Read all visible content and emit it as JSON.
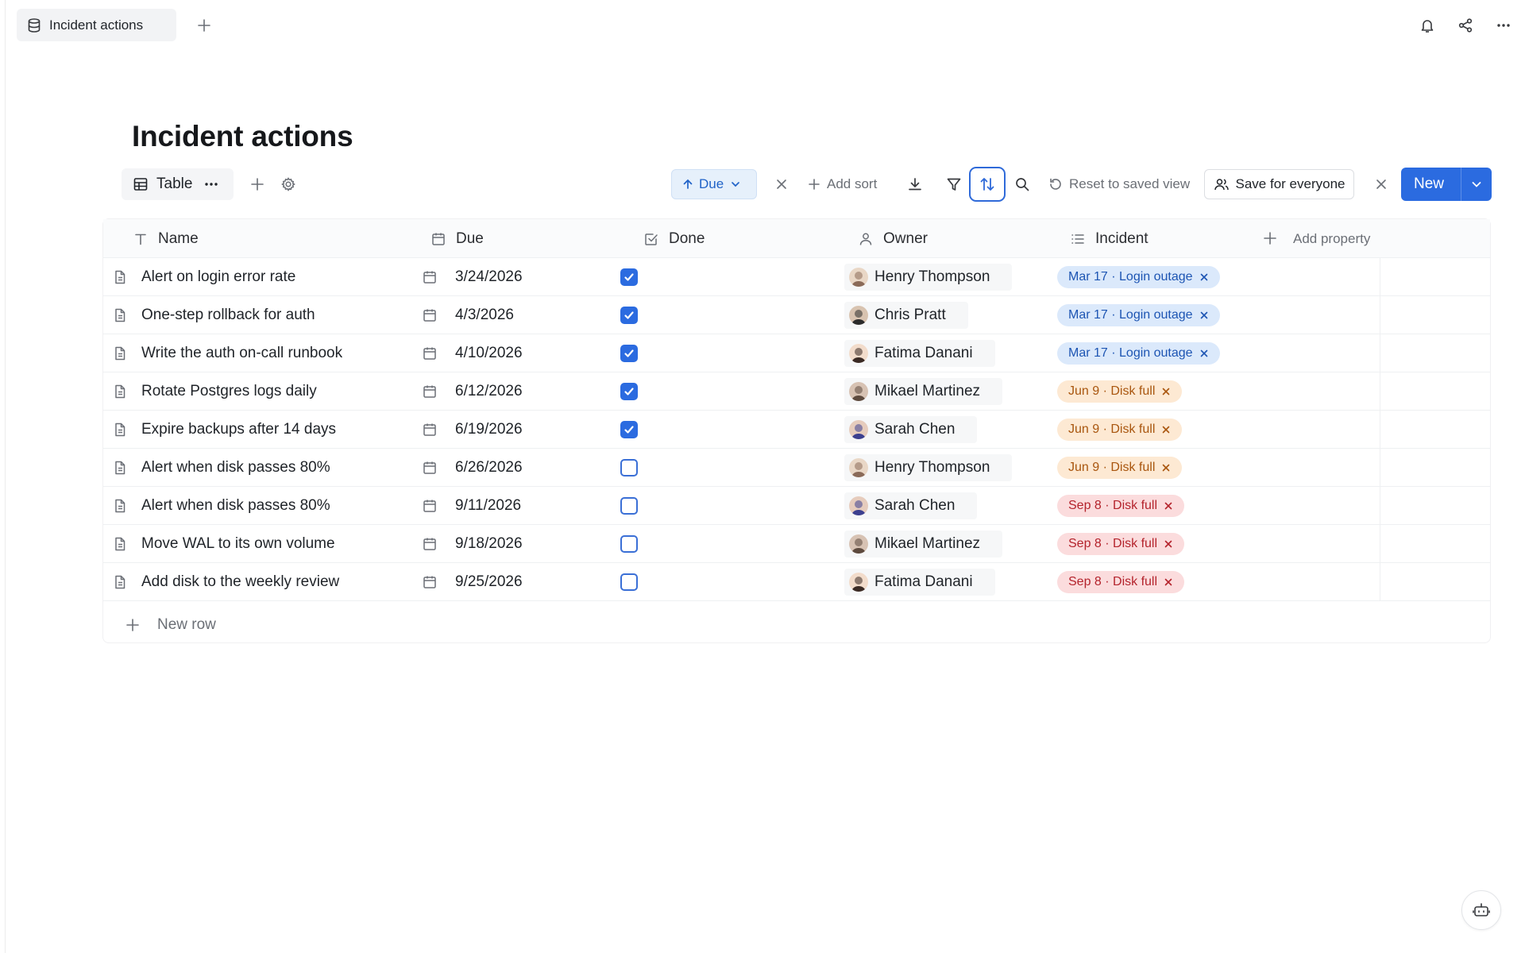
{
  "tab": {
    "title": "Incident actions"
  },
  "page": {
    "title": "Incident actions"
  },
  "toolbar": {
    "view_label": "Table",
    "sort_label": "Due",
    "add_sort_label": "Add sort",
    "reset_label": "Reset to saved view",
    "save_everyone_label": "Save for everyone",
    "new_label": "New"
  },
  "columns": {
    "name": "Name",
    "due": "Due",
    "done": "Done",
    "owner": "Owner",
    "incident": "Incident",
    "add_property": "Add property"
  },
  "rows": [
    {
      "name": "Alert on login error rate",
      "due": "3/24/2026",
      "done": true,
      "owner": "Henry Thompson",
      "incident": "Mar 17 · Login outage",
      "tag_color": "blue"
    },
    {
      "name": "One-step rollback for auth",
      "due": "4/3/2026",
      "done": true,
      "owner": "Chris Pratt",
      "incident": "Mar 17 · Login outage",
      "tag_color": "blue"
    },
    {
      "name": "Write the auth on-call runbook",
      "due": "4/10/2026",
      "done": true,
      "owner": "Fatima Danani",
      "incident": "Mar 17 · Login outage",
      "tag_color": "blue"
    },
    {
      "name": "Rotate Postgres logs daily",
      "due": "6/12/2026",
      "done": true,
      "owner": "Mikael Martinez",
      "incident": "Jun 9 · Disk full",
      "tag_color": "orange"
    },
    {
      "name": "Expire backups after 14 days",
      "due": "6/19/2026",
      "done": true,
      "owner": "Sarah Chen",
      "incident": "Jun 9 · Disk full",
      "tag_color": "orange"
    },
    {
      "name": "Alert when disk passes 80%",
      "due": "6/26/2026",
      "done": false,
      "owner": "Henry Thompson",
      "incident": "Jun 9 · Disk full",
      "tag_color": "orange"
    },
    {
      "name": "Alert when disk passes 80%",
      "due": "9/11/2026",
      "done": false,
      "owner": "Sarah Chen",
      "incident": "Sep 8 · Disk full",
      "tag_color": "red"
    },
    {
      "name": "Move WAL to its own volume",
      "due": "9/18/2026",
      "done": false,
      "owner": "Mikael Martinez",
      "incident": "Sep 8 · Disk full",
      "tag_color": "red"
    },
    {
      "name": "Add disk to the weekly review",
      "due": "9/25/2026",
      "done": false,
      "owner": "Fatima Danani",
      "incident": "Sep 8 · Disk full",
      "tag_color": "red"
    }
  ],
  "new_row_label": "New row",
  "colors": {
    "accent": "#2b6be0",
    "tag_blue": "#dbe9fb",
    "tag_orange": "#fde9d3",
    "tag_red": "#fbdcdd"
  },
  "icons": [
    "database-icon",
    "plus-icon",
    "bell-icon",
    "share-icon",
    "more-icon",
    "table-icon",
    "settings-icon",
    "arrow-up-icon",
    "chevron-down-icon",
    "close-icon",
    "download-icon",
    "filter-icon",
    "sort-icon",
    "search-icon",
    "reset-icon",
    "users-icon",
    "text-icon",
    "calendar-icon",
    "checkbox-icon",
    "person-icon",
    "list-icon",
    "document-icon",
    "bot-icon"
  ]
}
